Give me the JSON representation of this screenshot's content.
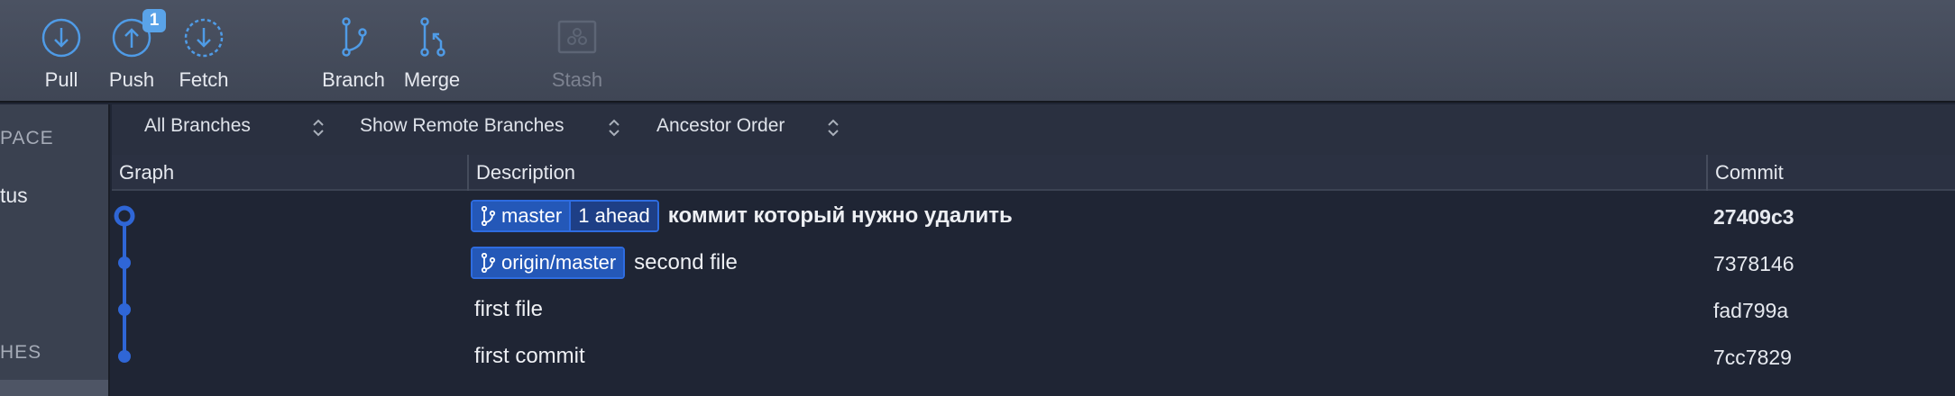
{
  "toolbar": {
    "pull": "Pull",
    "push": "Push",
    "push_badge": "1",
    "fetch": "Fetch",
    "branch": "Branch",
    "merge": "Merge",
    "stash": "Stash"
  },
  "sidebar": {
    "workspace_header": "PACE",
    "status_item": "tus",
    "branches_header": "HES"
  },
  "filters": {
    "branches": "All Branches",
    "remote": "Show Remote Branches",
    "order": "Ancestor Order"
  },
  "columns": {
    "graph": "Graph",
    "description": "Description",
    "commit": "Commit"
  },
  "commits": [
    {
      "branch": "master",
      "ahead": "1 ahead",
      "message": "коммит который нужно удалить",
      "hash": "27409c3"
    },
    {
      "branch": "origin/master",
      "message": "second file",
      "hash": "7378146"
    },
    {
      "message": "first file",
      "hash": "fad799a"
    },
    {
      "message": "first commit",
      "hash": "7cc7829"
    }
  ],
  "colors": {
    "accent": "#4f9be6",
    "graph": "#2f66d6",
    "tag": "#2458b8"
  }
}
